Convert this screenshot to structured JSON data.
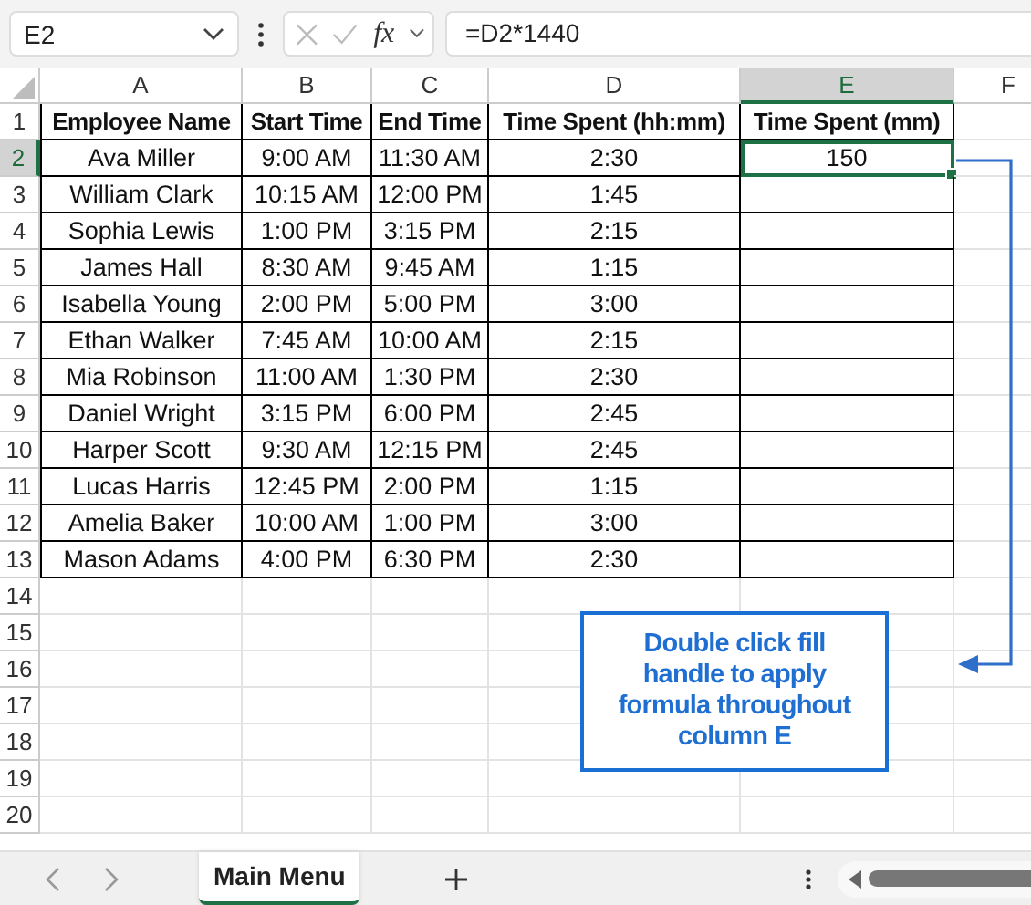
{
  "name_box": {
    "value": "E2"
  },
  "formula_bar": {
    "function_label": "fx",
    "value": "=D2*1440"
  },
  "columns": [
    {
      "label": "A",
      "selected": false
    },
    {
      "label": "B",
      "selected": false
    },
    {
      "label": "C",
      "selected": false
    },
    {
      "label": "D",
      "selected": false
    },
    {
      "label": "E",
      "selected": true
    },
    {
      "label": "F",
      "selected": false
    }
  ],
  "table": {
    "headers": [
      "Employee Name",
      "Start Time",
      "End Time",
      "Time Spent (hh:mm)",
      "Time Spent (mm)"
    ],
    "rows": [
      {
        "name": "Ava Miller",
        "start": "9:00 AM",
        "end": "11:30 AM",
        "spent": "2:30",
        "minutes": "150",
        "active": true
      },
      {
        "name": "William Clark",
        "start": "10:15 AM",
        "end": "12:00 PM",
        "spent": "1:45",
        "active": false
      },
      {
        "name": "Sophia Lewis",
        "start": "1:00 PM",
        "end": "3:15 PM",
        "spent": "2:15",
        "active": false
      },
      {
        "name": "James Hall",
        "start": "8:30 AM",
        "end": "9:45 AM",
        "spent": "1:15",
        "active": false
      },
      {
        "name": "Isabella Young",
        "start": "2:00 PM",
        "end": "5:00 PM",
        "spent": "3:00",
        "active": false
      },
      {
        "name": "Ethan Walker",
        "start": "7:45 AM",
        "end": "10:00 AM",
        "spent": "2:15",
        "active": false
      },
      {
        "name": "Mia Robinson",
        "start": "11:00 AM",
        "end": "1:30 PM",
        "spent": "2:30",
        "active": false
      },
      {
        "name": "Daniel Wright",
        "start": "3:15 PM",
        "end": "6:00 PM",
        "spent": "2:45",
        "active": false
      },
      {
        "name": "Harper Scott",
        "start": "9:30 AM",
        "end": "12:15 PM",
        "spent": "2:45",
        "active": false
      },
      {
        "name": "Lucas Harris",
        "start": "12:45 PM",
        "end": "2:00 PM",
        "spent": "1:15",
        "active": false
      },
      {
        "name": "Amelia Baker",
        "start": "10:00 AM",
        "end": "1:00 PM",
        "spent": "3:00",
        "active": false
      },
      {
        "name": "Mason Adams",
        "start": "4:00 PM",
        "end": "6:30 PM",
        "spent": "2:30",
        "active": false
      }
    ]
  },
  "row_numbers": [
    "1",
    "2",
    "3",
    "4",
    "5",
    "6",
    "7",
    "8",
    "9",
    "10",
    "11",
    "12",
    "13",
    "14",
    "15",
    "16",
    "17",
    "18",
    "19",
    "20"
  ],
  "callout": {
    "text": "Double click fill handle to apply formula throughout column E"
  },
  "sheet_tabs": [
    {
      "label": "Main Menu",
      "selected": true
    }
  ]
}
